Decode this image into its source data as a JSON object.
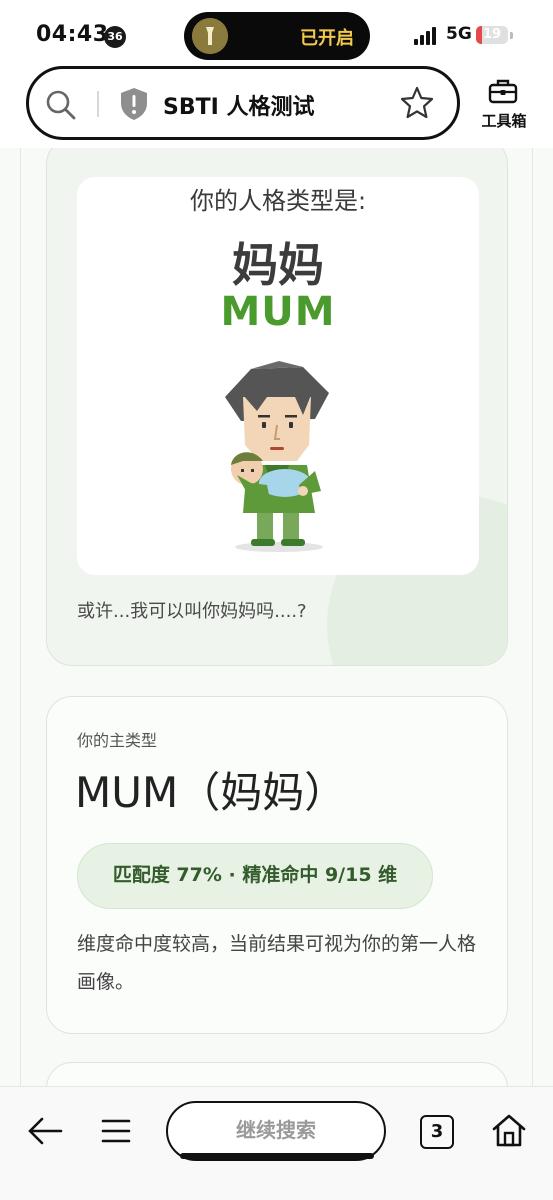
{
  "status_bar": {
    "time": "04:43",
    "notification_count": "36",
    "island_text": "已开启",
    "network": "5G",
    "battery_level": "19",
    "battery_fraction": 0.19
  },
  "browser": {
    "site_title": "SBTI 人格测试",
    "toolbox_label": "工具箱"
  },
  "result_card": {
    "prompt": "你的人格类型是:",
    "type_cn": "妈妈",
    "type_en": "MUM",
    "caption": "或许...我可以叫你妈妈吗....?"
  },
  "main_type_card": {
    "label": "你的主类型",
    "value": "MUM（妈妈）",
    "match": "匹配度 77% · 精准命中 9/15 维",
    "description": "维度命中度较高，当前结果可视为你的第一人格画像。"
  },
  "bottom_bar": {
    "continue_label": "继续搜索",
    "tab_count": "3"
  },
  "colors": {
    "accent_green": "#4a9a2e",
    "pill_bg": "#e7f2e4",
    "battery_low": "#e5484d",
    "island_text": "#f2c94c"
  },
  "icons": [
    "search-icon",
    "shield-icon",
    "star-icon",
    "toolbox-icon",
    "back-arrow-icon",
    "menu-icon",
    "home-icon",
    "flashlight-icon"
  ]
}
